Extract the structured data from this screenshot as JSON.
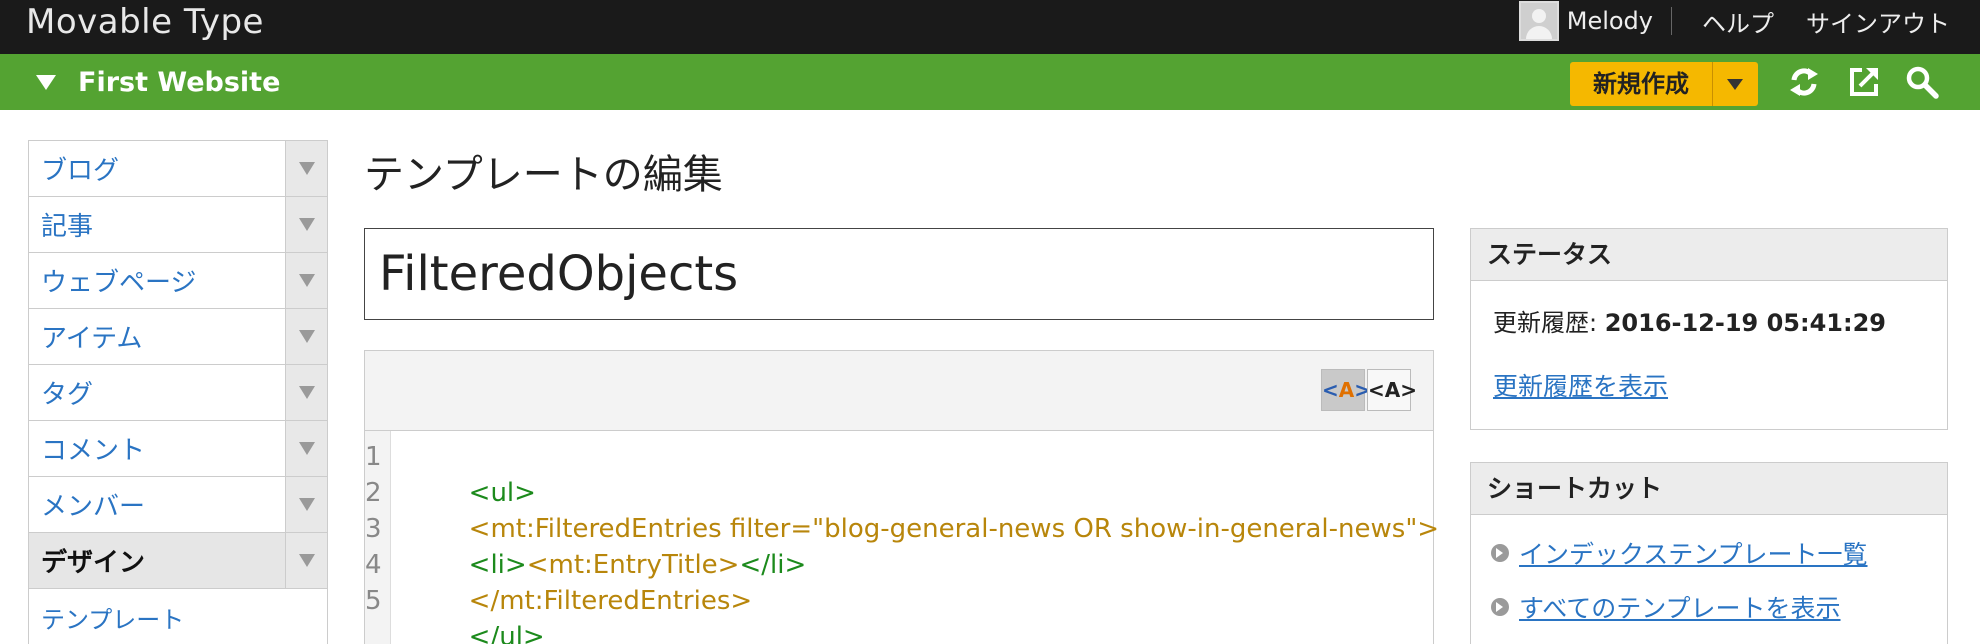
{
  "header": {
    "app_title": "Movable Type",
    "user_name": "Melody",
    "help_label": "ヘルプ",
    "signout_label": "サインアウト"
  },
  "sitebar": {
    "site_name": "First Website",
    "new_button_label": "新規作成",
    "icons": [
      "refresh-icon",
      "external-link-icon",
      "search-icon"
    ],
    "accent_color": "#54a332",
    "button_color": "#f5b800"
  },
  "sidebar": {
    "items": [
      {
        "label": "ブログ"
      },
      {
        "label": "記事"
      },
      {
        "label": "ウェブページ"
      },
      {
        "label": "アイテム"
      },
      {
        "label": "タグ"
      },
      {
        "label": "コメント"
      },
      {
        "label": "メンバー"
      },
      {
        "label": "デザイン",
        "active": true
      }
    ],
    "sub_items": [
      {
        "label": "テンプレート"
      }
    ]
  },
  "main": {
    "page_title": "テンプレートの編集",
    "template_name": "FilteredObjects",
    "editor": {
      "line_numbers": [
        "1",
        "2",
        "3",
        "4",
        "5"
      ],
      "lines": [
        [
          {
            "text": "<ul>",
            "color": "green"
          }
        ],
        [
          {
            "text": "<mt:FilteredEntries filter=\"blog-general-news OR show-in-general-news\">",
            "color": "gold"
          }
        ],
        [
          {
            "text": "<li>",
            "color": "green"
          },
          {
            "text": "<mt:EntryTitle>",
            "color": "gold"
          },
          {
            "text": "</li>",
            "color": "green"
          }
        ],
        [
          {
            "text": "</mt:FilteredEntries>",
            "color": "gold"
          }
        ],
        [
          {
            "text": "</ul>",
            "color": "green"
          }
        ]
      ]
    }
  },
  "status_panel": {
    "title": "ステータス",
    "updated_label": "更新履歴: ",
    "updated_value": "2016-12-19 05:41:29",
    "history_link": "更新履歴を表示"
  },
  "shortcut_panel": {
    "title": "ショートカット",
    "links": [
      "インデックステンプレート一覧",
      "すべてのテンプレートを表示"
    ]
  }
}
